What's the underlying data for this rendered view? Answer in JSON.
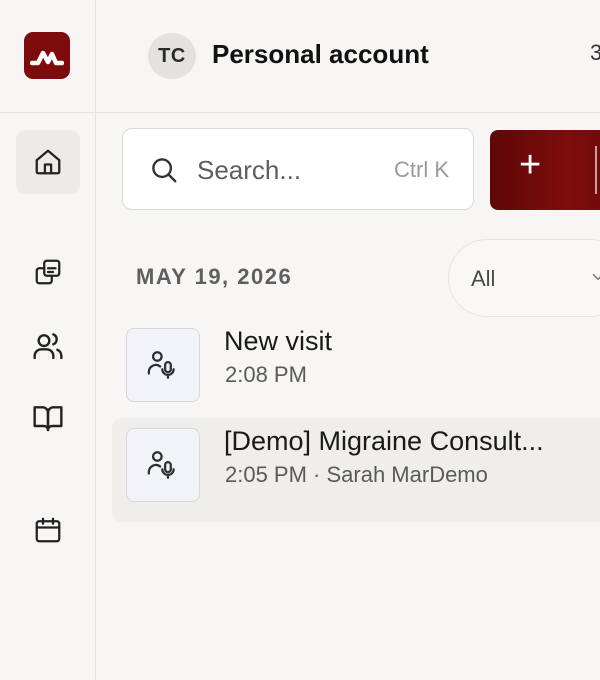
{
  "account": {
    "initials": "TC",
    "name": "Personal account",
    "clipped_text": "3"
  },
  "search": {
    "placeholder": "Search...",
    "shortcut": "Ctrl K"
  },
  "new_button": {
    "icon": "plus-icon",
    "label": "+"
  },
  "list": {
    "date_header": "MAY 19, 2026",
    "filter": {
      "selected": "All"
    },
    "items": [
      {
        "title": "New visit",
        "subtitle": "2:08 PM",
        "icon": "mic-user-icon"
      },
      {
        "title": "[Demo] Migraine Consult...",
        "subtitle": "2:05 PM · Sarah MarDemo",
        "icon": "mic-user-icon"
      }
    ]
  },
  "sidebar": {
    "items": [
      {
        "name": "home",
        "icon": "home-icon"
      },
      {
        "name": "copy",
        "icon": "copy-icon"
      },
      {
        "name": "patients",
        "icon": "users-icon"
      },
      {
        "name": "library",
        "icon": "book-icon"
      },
      {
        "name": "calendar",
        "icon": "calendar-icon"
      }
    ]
  },
  "colors": {
    "brand": "#7d0b0b",
    "background": "#f7f6f4"
  }
}
